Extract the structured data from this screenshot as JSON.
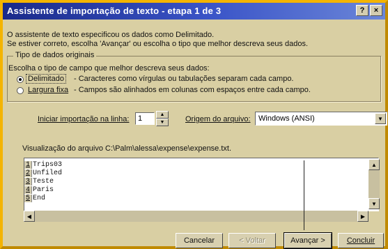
{
  "window": {
    "title": "Assistente de importação de texto - etapa 1 de 3",
    "help_label": "?",
    "close_label": "×"
  },
  "intro": {
    "line1": "O assistente de texto especificou os dados como Delimitado.",
    "line2": "Se estiver correto, escolha 'Avançar' ou escolha o tipo que melhor descreva seus dados."
  },
  "data_type_group": {
    "legend": "Tipo de dados originais",
    "prompt": "Escolha o tipo de campo que melhor descreva seus dados:",
    "options": [
      {
        "label": "Delimitado",
        "desc": "- Caracteres como vírgulas ou tabulações separam cada campo.",
        "selected": true
      },
      {
        "label": "Largura fixa",
        "desc": "- Campos são alinhados em colunas com espaços entre cada campo.",
        "selected": false
      }
    ]
  },
  "import_start": {
    "label": "Iniciar importação na linha:",
    "value": "1"
  },
  "file_origin": {
    "label": "Origem do arquivo:",
    "value": "Windows (ANSI)"
  },
  "preview": {
    "label": "Visualização do arquivo C:\\Palm\\alessa\\expense\\expense.txt.",
    "rows": [
      {
        "num": "1",
        "text": "Trips03"
      },
      {
        "num": "2",
        "text": "Unfiled"
      },
      {
        "num": "3",
        "text": "Teste"
      },
      {
        "num": "4",
        "text": "Paris"
      },
      {
        "num": "5",
        "text": "End"
      }
    ]
  },
  "buttons": {
    "cancel": "Cancelar",
    "back": "< Voltar",
    "next": "Avançar >",
    "finish": "Concluir"
  }
}
